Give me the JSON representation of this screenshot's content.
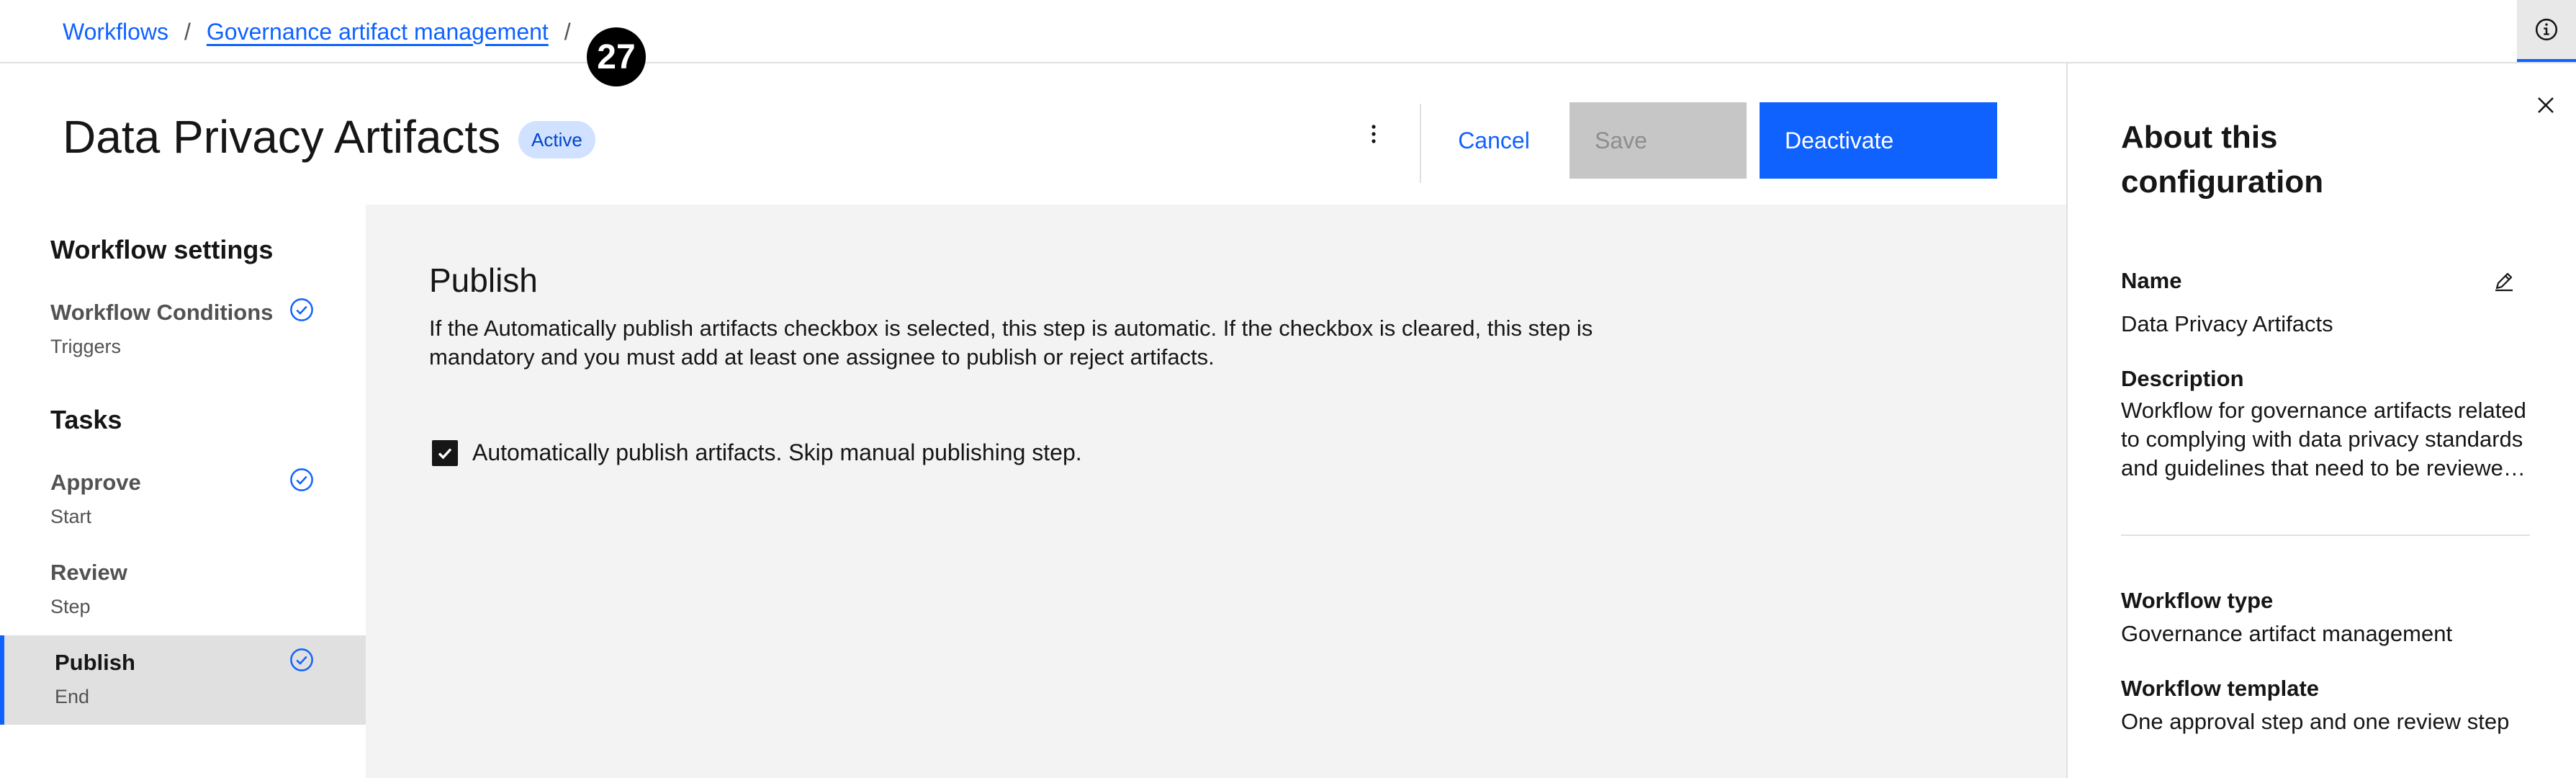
{
  "breadcrumb": {
    "items": [
      "Workflows",
      "Governance artifact management"
    ],
    "separator": "/"
  },
  "step_badge": "27",
  "header": {
    "title": "Data Privacy Artifacts",
    "status": "Active",
    "cancel_label": "Cancel",
    "save_label": "Save",
    "deactivate_label": "Deactivate"
  },
  "sidebar": {
    "section_settings": "Workflow settings",
    "conditions": {
      "label": "Workflow Conditions",
      "sub": "Triggers",
      "complete": true
    },
    "section_tasks": "Tasks",
    "tasks": [
      {
        "label": "Approve",
        "sub": "Start",
        "complete": true,
        "selected": false
      },
      {
        "label": "Review",
        "sub": "Step",
        "complete": false,
        "selected": false
      },
      {
        "label": "Publish",
        "sub": "End",
        "complete": true,
        "selected": true
      }
    ]
  },
  "main": {
    "title": "Publish",
    "description": "If the Automatically publish artifacts checkbox is selected, this step is automatic. If the checkbox is cleared, this step is mandatory and you must add at least one assignee to publish or reject artifacts.",
    "checkbox_label": "Automatically publish artifacts. Skip manual publishing step.",
    "checkbox_checked": true
  },
  "panel": {
    "title": "About this configuration",
    "name_label": "Name",
    "name_value": "Data Privacy Artifacts",
    "description_label": "Description",
    "description_value": "Workflow for governance artifacts related to complying with data privacy standards and guidelines that need to be reviewed and approved.",
    "type_label": "Workflow type",
    "type_value": "Governance artifact management",
    "template_label": "Workflow template",
    "template_value": "One approval step and one review step"
  },
  "colors": {
    "accent": "#0f62fe",
    "tag_bg": "#d0e2ff",
    "disabled_bg": "#c6c6c6",
    "content_bg": "#f3f3f3",
    "selected_bg": "#e0e0e0"
  },
  "icons": [
    "information-icon",
    "overflow-menu-icon",
    "checkmark-outline-icon",
    "checkbox-checked-icon",
    "close-icon",
    "edit-icon"
  ]
}
